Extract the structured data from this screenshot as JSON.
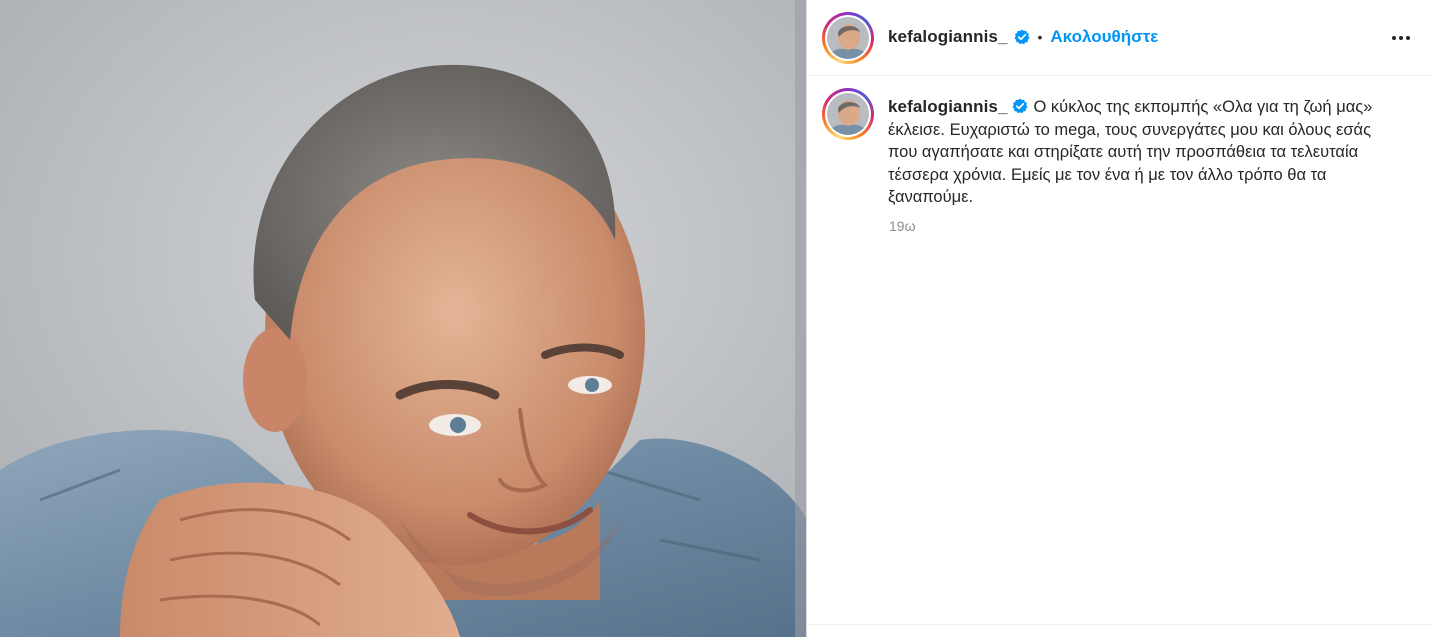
{
  "photo": {
    "alt_subject": "portrait-photo"
  },
  "header": {
    "username": "kefalogiannis_",
    "separator": "•",
    "follow_label": "Ακολουθήστε",
    "more_icon": "more-horizontal-icon"
  },
  "caption": {
    "username": "kefalogiannis_",
    "text": "Ο κύκλος της εκπομπής «Ολα για τη ζωή μας» έκλεισε. Ευχαριστώ το mega, τους συνεργάτες μου και όλους εσάς που αγαπήσατε και στηρίξατε αυτή την προσπάθεια τα τελευταία τέσσερα χρόνια. Εμείς με τον ένα ή με τον άλλο τρόπο θα τα ξαναπούμε.",
    "timestamp": "19ω"
  },
  "colors": {
    "verified": "#0095f6",
    "follow": "#0095f6",
    "muted": "#8e8e8e",
    "text": "#262626"
  }
}
